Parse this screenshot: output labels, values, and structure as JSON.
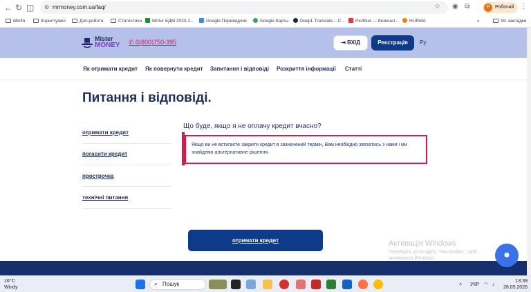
{
  "browser": {
    "url": "mrmoney.com.ua/faq/",
    "profile_label": "Робочий",
    "profile_initial": "Р",
    "bookmarks": [
      "Minfin",
      "Користувачі",
      "Доп.робота",
      "Статистика",
      "Мітінг БДМ 2023-2...",
      "Google Переводчик",
      "Google Карты",
      "DeepL Translate – С...",
      "Pic4Net — безкошт...",
      "HURMA"
    ],
    "bookmarks_more": "»",
    "all_bookmarks": "Усі закладки"
  },
  "header": {
    "logo_top": "Mister",
    "logo_bottom": "MONEY",
    "phone": "0(800)750-395",
    "login_label": "ВХІД",
    "register_label": "Реєстрація",
    "lang": "Ру"
  },
  "menu": [
    "Як отримати кредит",
    "Як повернути кредит",
    "Запитання і відповіді",
    "Розкриття інформації",
    "Статті"
  ],
  "page": {
    "title": "Питання і відповіді.",
    "side_links": [
      "отримати кредит",
      "погасити кредит",
      "прострочка",
      "технічні питання"
    ],
    "question": "Що буде, якщо я не оплачу кредит вчасно?",
    "answer": "Якщо ви не встигаєте закрити кредит в зазначений термін, Вам необхідно звязатись з нами і ми знайдемо альтернативне рішення.",
    "cta_label": "отримати кредит"
  },
  "watermark": {
    "title": "Активація Windows",
    "text": "Перейдіть до розділу \"Настройки\", щоб активувати Windows."
  },
  "taskbar": {
    "temp": "16°C",
    "weather": "Windy",
    "search": "Пошук",
    "lang": "УКР",
    "time": "13:39",
    "date": "28.05.2026"
  }
}
